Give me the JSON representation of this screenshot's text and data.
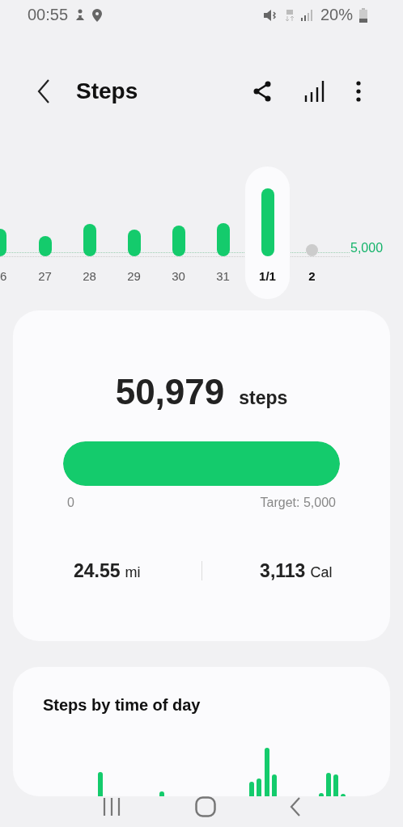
{
  "status_bar": {
    "time": "00:55",
    "battery": "20%"
  },
  "header": {
    "title": "Steps"
  },
  "day_chart": {
    "target_label": "5,000",
    "days": [
      {
        "label": "6",
        "kind": "bar",
        "selected": false
      },
      {
        "label": "27",
        "kind": "bar",
        "selected": false
      },
      {
        "label": "28",
        "kind": "bar",
        "selected": false
      },
      {
        "label": "29",
        "kind": "bar",
        "selected": false
      },
      {
        "label": "30",
        "kind": "bar",
        "selected": false
      },
      {
        "label": "31",
        "kind": "bar",
        "selected": false
      },
      {
        "label": "1/1",
        "kind": "bar",
        "selected": true
      },
      {
        "label": "2",
        "kind": "empty",
        "selected": false
      }
    ]
  },
  "summary": {
    "steps": "50,979",
    "steps_unit": "steps",
    "progress": {
      "level": 1,
      "start_label": "0",
      "target_label": "Target: 5,000"
    },
    "distance": {
      "value": "24.55",
      "unit": "mi"
    },
    "calories": {
      "value": "3,113",
      "unit": "Cal"
    }
  },
  "time_of_day": {
    "title": "Steps by time of day"
  }
}
